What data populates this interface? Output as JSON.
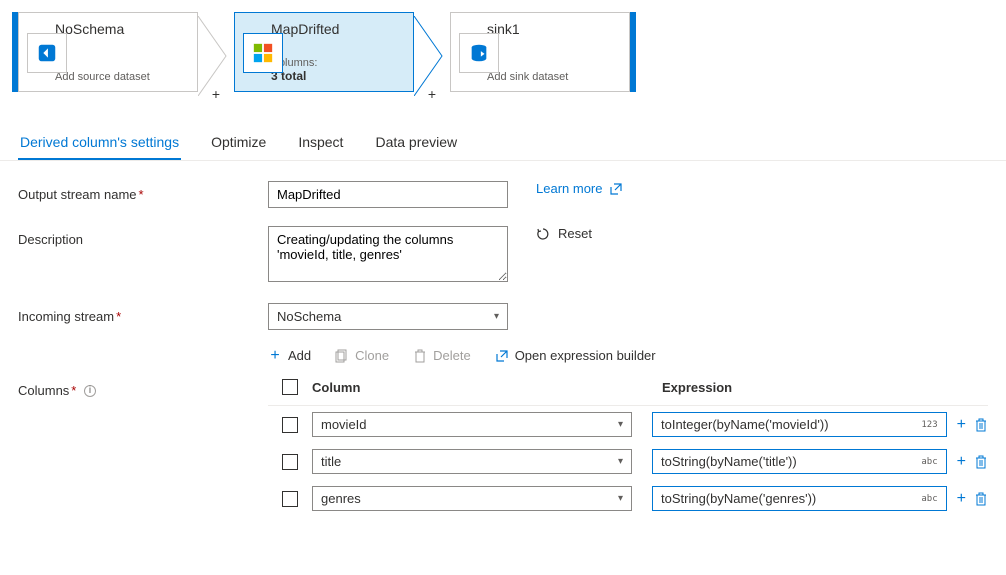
{
  "flow": {
    "nodes": [
      {
        "title": "NoSchema",
        "subtitle": "Add source dataset",
        "icon": "source"
      },
      {
        "title": "MapDrifted",
        "label1": "Columns:",
        "label2": "3 total",
        "icon": "derive",
        "selected": true
      },
      {
        "title": "sink1",
        "subtitle": "Add sink dataset",
        "icon": "sink"
      }
    ]
  },
  "tabs": [
    "Derived column's settings",
    "Optimize",
    "Inspect",
    "Data preview"
  ],
  "form": {
    "output_stream_label": "Output stream name",
    "output_stream_value": "MapDrifted",
    "learn_more": "Learn more",
    "description_label": "Description",
    "description_value": "Creating/updating the columns 'movieId, title, genres'",
    "reset": "Reset",
    "incoming_label": "Incoming stream",
    "incoming_value": "NoSchema"
  },
  "columns_toolbar": {
    "add": "Add",
    "clone": "Clone",
    "delete": "Delete",
    "open_builder": "Open expression builder"
  },
  "columns": {
    "label": "Columns",
    "header_column": "Column",
    "header_expression": "Expression",
    "rows": [
      {
        "column": "movieId",
        "expression": "toInteger(byName('movieId'))",
        "type_badge": "123"
      },
      {
        "column": "title",
        "expression": "toString(byName('title'))",
        "type_badge": "abc"
      },
      {
        "column": "genres",
        "expression": "toString(byName('genres'))",
        "type_badge": "abc"
      }
    ]
  }
}
